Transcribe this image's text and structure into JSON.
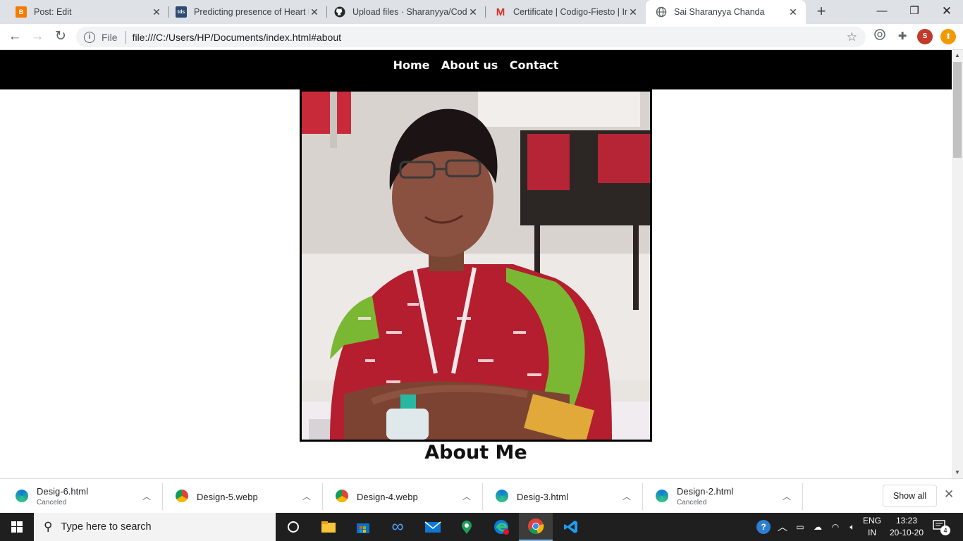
{
  "browser": {
    "tabs": [
      {
        "title": "Post: Edit",
        "icon": "blogger-icon",
        "active": false
      },
      {
        "title": "Predicting presence of Heart D",
        "icon": "tds-icon",
        "active": false
      },
      {
        "title": "Upload files · Sharanyya/Codig",
        "icon": "github-icon",
        "active": false
      },
      {
        "title": "Certificate | Codigo-Fiesto | Int",
        "icon": "gmail-icon",
        "active": false
      },
      {
        "title": "Sai Sharanyya Chanda",
        "icon": "globe-icon",
        "active": true
      }
    ],
    "address": {
      "scheme": "File",
      "url": "file:///C:/Users/HP/Documents/index.html#about"
    },
    "profile_initial": "S"
  },
  "site": {
    "nav": [
      "Home",
      "About us",
      "Contact"
    ],
    "about_heading": "About Me"
  },
  "downloads": {
    "items": [
      {
        "name": "Desig-6.html",
        "status": "Canceled",
        "icon": "edge-icon"
      },
      {
        "name": "Design-5.webp",
        "status": "",
        "icon": "chrome-icon"
      },
      {
        "name": "Design-4.webp",
        "status": "",
        "icon": "chrome-icon"
      },
      {
        "name": "Desig-3.html",
        "status": "",
        "icon": "edge-icon"
      },
      {
        "name": "Design-2.html",
        "status": "Canceled",
        "icon": "edge-icon"
      }
    ],
    "show_all": "Show all"
  },
  "taskbar": {
    "search_placeholder": "Type here to search",
    "lang_top": "ENG",
    "lang_bottom": "IN",
    "time": "13:23",
    "date": "20-10-20",
    "notification_count": "4"
  },
  "colors": {
    "nav_bg": "#000000",
    "tab_strip": "#dee1e6",
    "taskbar": "#1f1f1f",
    "accent_blue": "#76b9ed"
  }
}
